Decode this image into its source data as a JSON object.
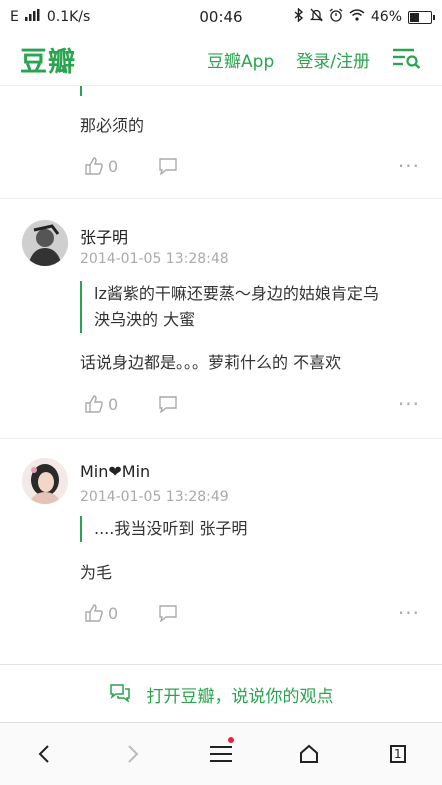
{
  "status_bar": {
    "carrier": "E",
    "speed": "0.1K/s",
    "time": "00:46",
    "battery_percent": "46%",
    "battery_level": 0.46
  },
  "top_nav": {
    "logo": "豆瓣",
    "app_link": "豆瓣App",
    "login_link": "登录/注册"
  },
  "first_comment_tail": {
    "body": "那必须的",
    "likes": "0"
  },
  "comments": [
    {
      "author": "张子明",
      "time": "2014-01-05 13:28:48",
      "quote_line1": "lz酱紫的干嘛还要蒸～身边的姑娘肯定乌",
      "quote_line2": "泱乌泱的 大蜜",
      "body": "话说身边都是。。。萝莉什么的 不喜欢",
      "likes": "0"
    },
    {
      "author": "Min❤Min",
      "time": "2014-01-05 13:28:49",
      "quote_line1": "....我当没听到 张子明",
      "body": "为毛",
      "likes": "0"
    }
  ],
  "cta": {
    "label": "打开豆瓣，说说你的观点"
  },
  "browser_bar": {
    "tab_count": "1"
  },
  "colors": {
    "accent": "#2aa44f",
    "muted": "#aaaaaa"
  },
  "icons": [
    "signal-icon",
    "bluetooth-icon",
    "mute-icon",
    "alarm-icon",
    "wifi-icon",
    "battery-icon",
    "menu-search-icon",
    "like-icon",
    "reply-icon",
    "more-icon",
    "comment-bubble-icon",
    "back-icon",
    "forward-icon",
    "menu-icon",
    "home-icon",
    "tabs-icon"
  ]
}
